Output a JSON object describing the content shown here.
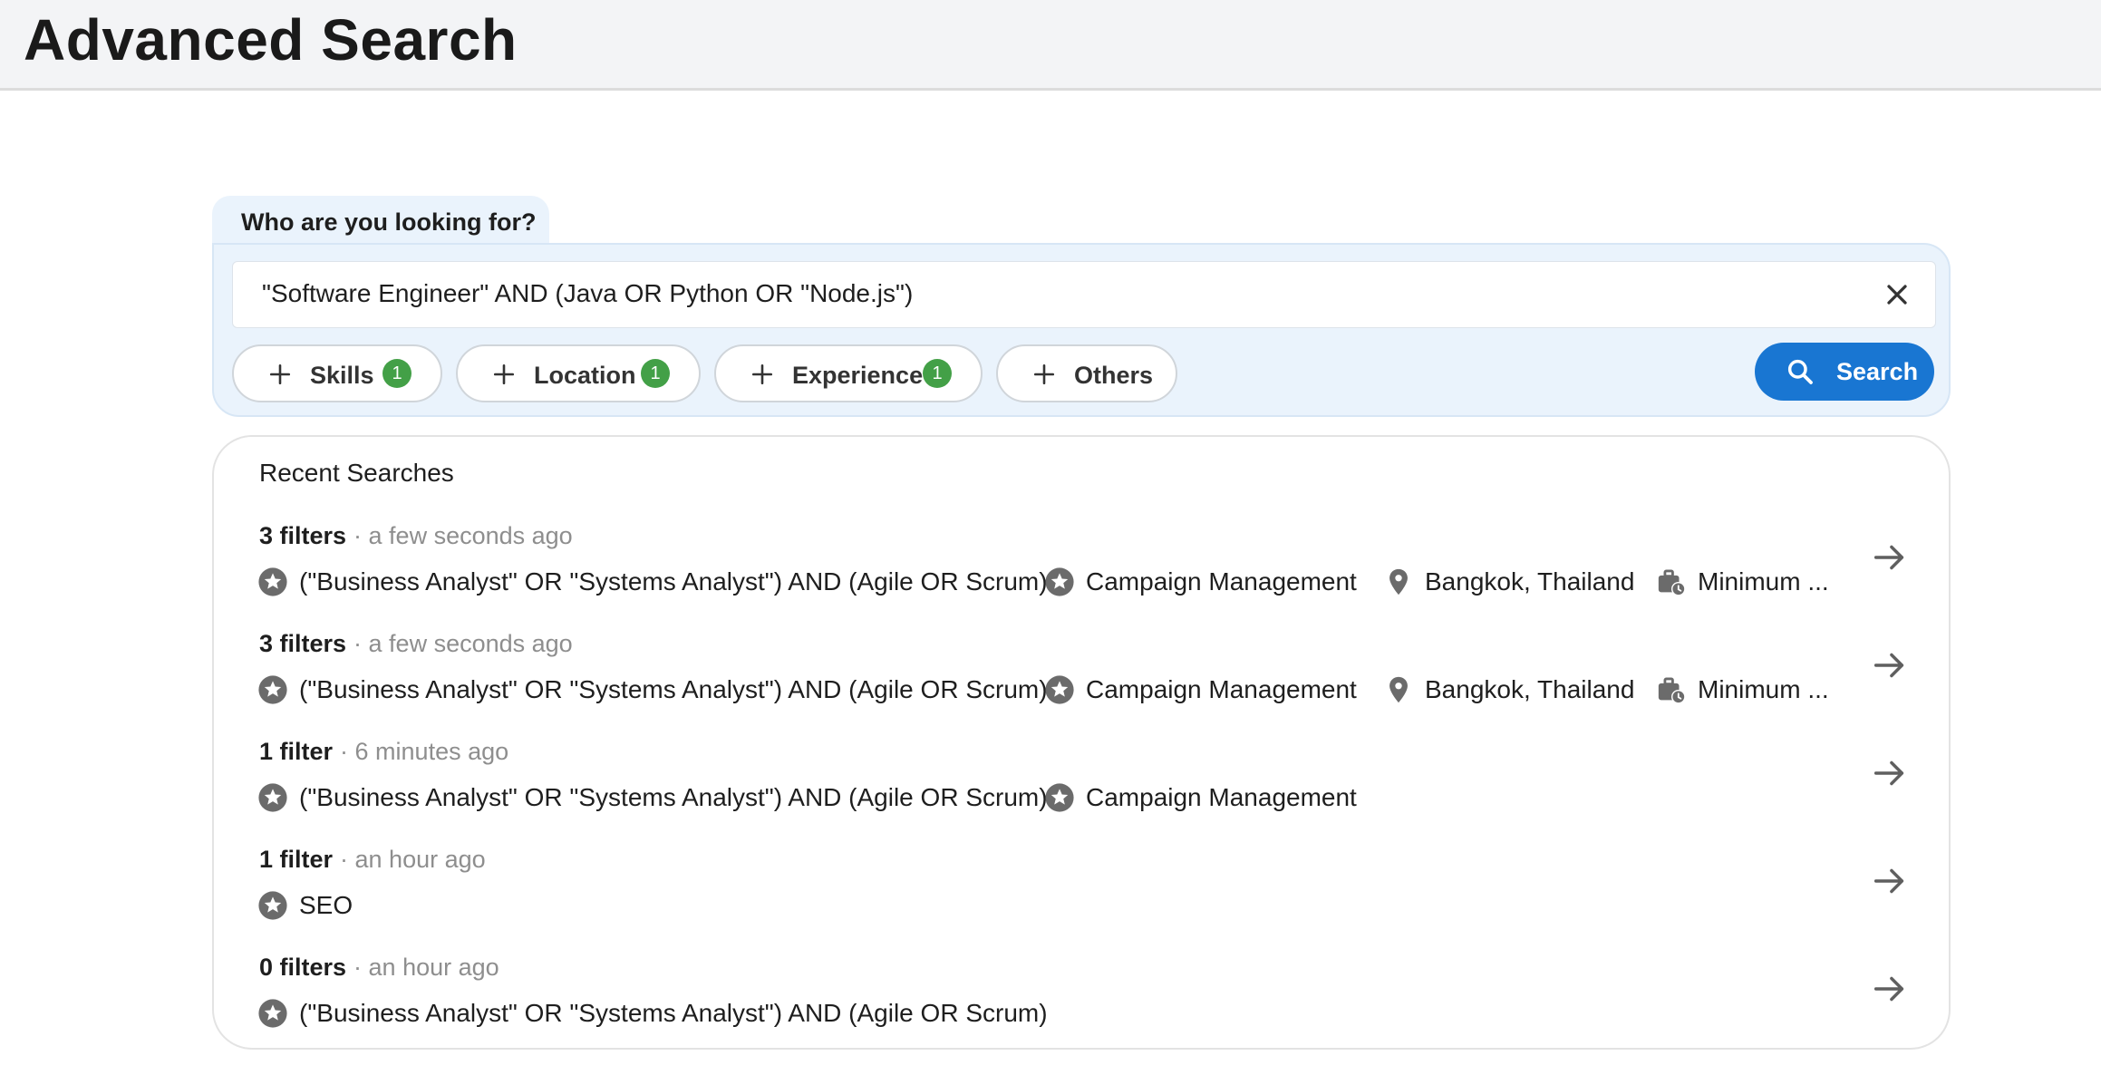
{
  "header": {
    "title": "Advanced Search"
  },
  "search": {
    "tab_label": "Who are you looking for?",
    "query": "\"Software Engineer\" AND (Java OR Python OR \"Node.js\")",
    "chips": [
      {
        "label": "Skills",
        "count": "1"
      },
      {
        "label": "Location",
        "count": "1"
      },
      {
        "label": "Experience",
        "count": "1"
      },
      {
        "label": "Others"
      }
    ],
    "button_label": "Search",
    "button_color": "#1976d2",
    "badge_color": "#43a047"
  },
  "recent": {
    "title": "Recent Searches",
    "rows": [
      {
        "count": "3 filters",
        "time": "· a few seconds ago",
        "chips": [
          {
            "icon": "star-icon",
            "text": "(\"Business Analyst\" OR \"Systems Analyst\") AND (Agile OR Scrum)"
          },
          {
            "icon": "star-icon",
            "text": "Campaign Management"
          },
          {
            "icon": "location-pin-icon",
            "text": "Bangkok, Thailand"
          },
          {
            "icon": "briefcase-clock-icon",
            "text": "Minimum ..."
          }
        ]
      },
      {
        "count": "3 filters",
        "time": "· a few seconds ago",
        "chips": [
          {
            "icon": "star-icon",
            "text": "(\"Business Analyst\" OR \"Systems Analyst\") AND (Agile OR Scrum)"
          },
          {
            "icon": "star-icon",
            "text": "Campaign Management"
          },
          {
            "icon": "location-pin-icon",
            "text": "Bangkok, Thailand"
          },
          {
            "icon": "briefcase-clock-icon",
            "text": "Minimum ..."
          }
        ]
      },
      {
        "count": "1 filter",
        "time": "· 6 minutes ago",
        "chips": [
          {
            "icon": "star-icon",
            "text": "(\"Business Analyst\" OR \"Systems Analyst\") AND (Agile OR Scrum)"
          },
          {
            "icon": "star-icon",
            "text": "Campaign Management"
          }
        ]
      },
      {
        "count": "1 filter",
        "time": "· an hour ago",
        "chips": [
          {
            "icon": "star-icon",
            "text": "SEO"
          }
        ]
      },
      {
        "count": "0 filters",
        "time": "· an hour ago",
        "chips": [
          {
            "icon": "star-icon",
            "text": "(\"Business Analyst\" OR \"Systems Analyst\") AND (Agile OR Scrum)"
          }
        ]
      }
    ]
  }
}
